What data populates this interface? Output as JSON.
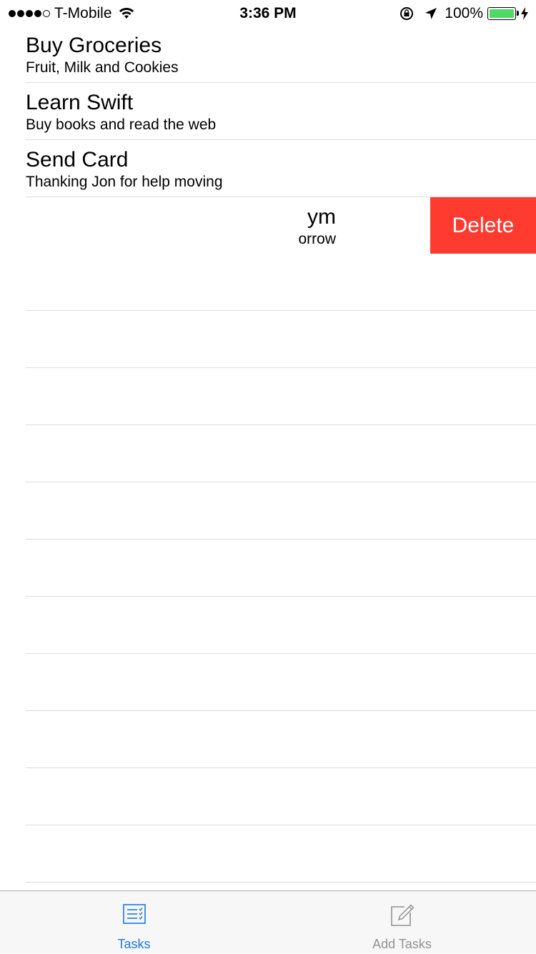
{
  "status_bar": {
    "carrier": "T-Mobile",
    "time": "3:36 PM",
    "battery": "100%",
    "signal_bars_filled": 4,
    "signal_bars_total": 5
  },
  "tasks": [
    {
      "title": "Buy Groceries",
      "subtitle": "Fruit, Milk and Cookies"
    },
    {
      "title": "Learn Swift",
      "subtitle": "Buy books and read the web"
    },
    {
      "title": "Send Card",
      "subtitle": "Thanking Jon for help moving"
    }
  ],
  "swiped_task": {
    "title_visible": "ym",
    "subtitle_visible": "orrow",
    "delete_label": "Delete"
  },
  "tab_bar": {
    "tabs": [
      {
        "label": "Tasks",
        "icon": "task-list-icon",
        "active": true
      },
      {
        "label": "Add Tasks",
        "icon": "compose-icon",
        "active": false
      }
    ]
  },
  "colors": {
    "delete_red": "#ff3b30",
    "tab_active": "#1a7ae0",
    "tab_inactive": "#929292",
    "battery_green": "#4cd964"
  }
}
